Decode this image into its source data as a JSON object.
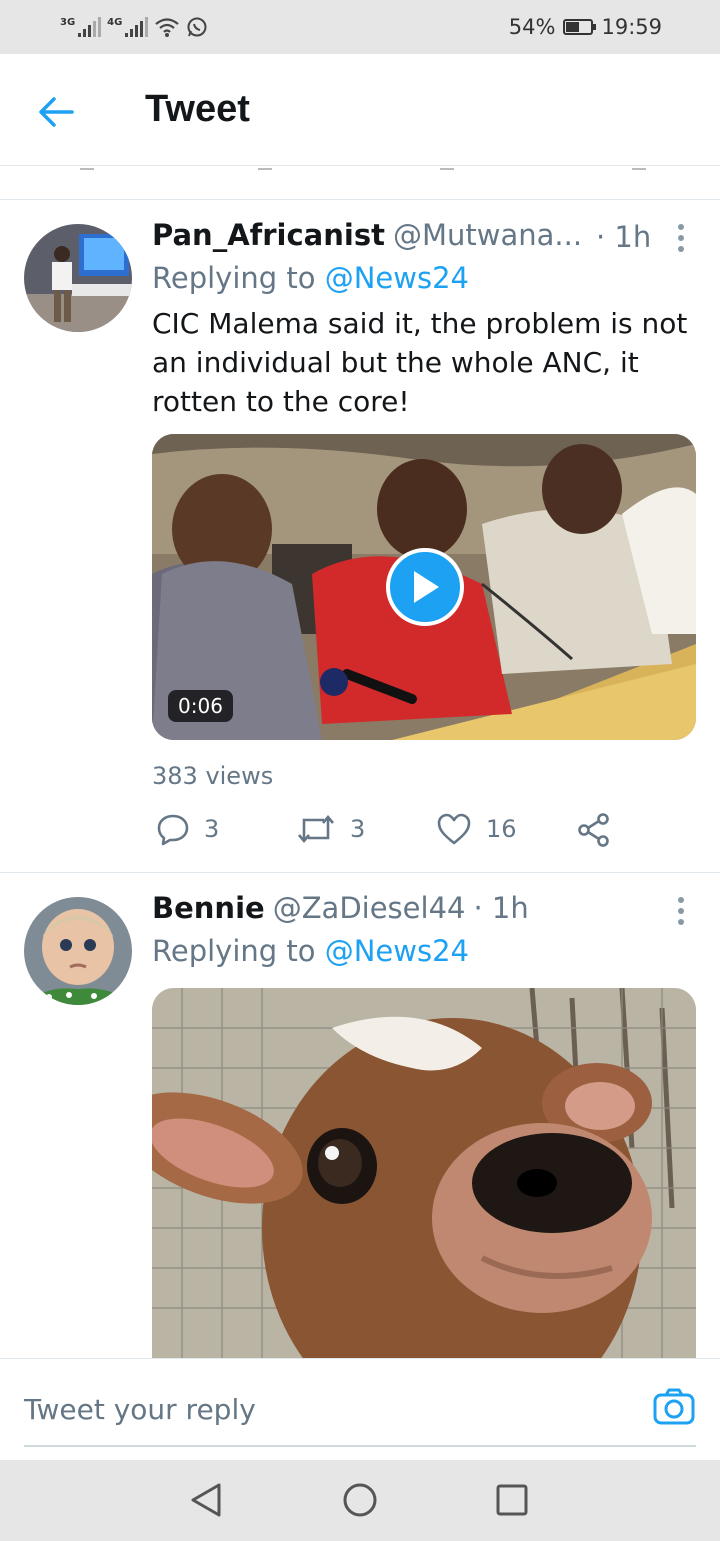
{
  "status_bar": {
    "signal1_label": "3G",
    "signal2_label": "4G",
    "battery_percent": "54%",
    "battery_level": 0.54,
    "time": "19:59",
    "icons": [
      "signal-icon",
      "signal-icon",
      "wifi-icon",
      "whatsapp-icon",
      "battery-icon"
    ]
  },
  "header": {
    "title": "Tweet",
    "back_icon": "arrow-left-icon"
  },
  "tweets": [
    {
      "name": "Pan_Africanist",
      "handle": "@Mutwana...",
      "time": "· 1h",
      "replying_prefix": "Replying to",
      "replying_to": "@News24",
      "text": "CIC Malema said it, the problem is not an individual but the whole ANC, it rotten to the core!",
      "video_duration": "0:06",
      "views": "383 views",
      "replies": "3",
      "retweets": "3",
      "likes": "16"
    },
    {
      "name": "Bennie",
      "handle": "@ZaDiesel44",
      "time": "· 1h",
      "replying_prefix": "Replying to",
      "replying_to": "@News24"
    }
  ],
  "reply_bar": {
    "placeholder": "Tweet your reply",
    "camera_icon": "camera-icon"
  },
  "nav_bar": {
    "icons": [
      "back-triangle-icon",
      "home-circle-icon",
      "recents-square-icon"
    ]
  },
  "colors": {
    "accent": "#1da1f2",
    "secondary_text": "#657786",
    "primary_text": "#14171a"
  }
}
